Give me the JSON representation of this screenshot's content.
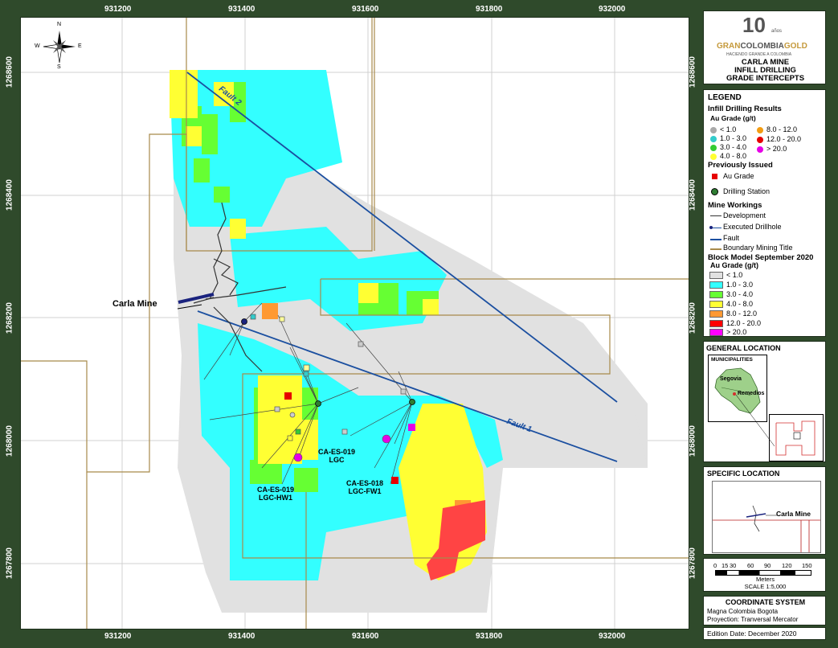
{
  "axis": {
    "x_ticks": [
      "931200",
      "931400",
      "931600",
      "931800",
      "932000"
    ],
    "y_ticks": [
      "1268600",
      "1268400",
      "1268200",
      "1268000",
      "1267800"
    ]
  },
  "compass": {
    "n": "N",
    "s": "S",
    "e": "E",
    "w": "W"
  },
  "map_labels": {
    "carla_mine": "Carla Mine",
    "fault1": "Fault 1",
    "fault2": "Fault 2",
    "drill1_line1": "CA-ES-019",
    "drill1_line2": "LGC",
    "drill2_line1": "CA-ES-019",
    "drill2_line2": "LGC-HW1",
    "drill3_line1": "CA-ES-018",
    "drill3_line2": "LGC-FW1"
  },
  "logo": {
    "number": "10",
    "small": "años",
    "brand_part1": "GRAN",
    "brand_part2": "COLOMBIA",
    "brand_part3": "GOLD",
    "tagline": "HACIENDO GRANDE A COLOMBIA",
    "title_lines": [
      "CARLA MINE",
      "INFILL DRILLING",
      "GRADE INTERCEPTS"
    ]
  },
  "legend": {
    "title": "LEGEND",
    "infill_title": "Infill Drilling Results",
    "au_grade": "Au Grade (g/t)",
    "infill_left": [
      {
        "label": "< 1.0",
        "color": "#a9a9a9"
      },
      {
        "label": "1.0 - 3.0",
        "color": "#33cccc"
      },
      {
        "label": "3.0 - 4.0",
        "color": "#33cc33"
      },
      {
        "label": "4.0 - 8.0",
        "color": "#ffff33"
      }
    ],
    "infill_right": [
      {
        "label": "8.0 - 12.0",
        "color": "#f39c12"
      },
      {
        "label": "12.0 - 20.0",
        "color": "#e60000"
      },
      {
        "label": "> 20.0",
        "color": "#e600e6"
      }
    ],
    "prev_title": "Previously Issued",
    "prev_au": "Au Grade",
    "prev_station": "Drilling Station",
    "mine_title": "Mine Workings",
    "mine_items": [
      "Development",
      "Executed Drillhole",
      "Fault",
      "Boundary Mining Title"
    ],
    "block_title": "Block Model September 2020",
    "block_grade": "Au Grade (g/t)",
    "block_items": [
      {
        "label": "< 1.0",
        "color": "#e1e1e1"
      },
      {
        "label": "1.0 - 3.0",
        "color": "#33ffff"
      },
      {
        "label": "3.0 - 4.0",
        "color": "#66ff33"
      },
      {
        "label": "4.0 - 8.0",
        "color": "#ffff33"
      },
      {
        "label": "8.0 - 12.0",
        "color": "#ff9933"
      },
      {
        "label": "12.0 - 20.0",
        "color": "#ff0000"
      },
      {
        "label": "> 20.0",
        "color": "#ff00ff"
      }
    ]
  },
  "general_location": {
    "title": "GENERAL LOCATION",
    "inset_title": "MUNICIPALITIES",
    "segovia": "Segovia",
    "remedios": "Remedios"
  },
  "specific_location": {
    "title": "SPECIFIC LOCATION",
    "label": "Carla Mine"
  },
  "scale": {
    "ticks": [
      "0",
      "15",
      "30",
      "60",
      "90",
      "120",
      "150"
    ],
    "units": "Meters",
    "text": "SCALE 1:5,000"
  },
  "coord": {
    "title": "COORDINATE SYSTEM",
    "line1": "Magna Colombia Bogota",
    "line2": "Proyection: Tranversal Mercator",
    "edition": "Edition Date: December 2020"
  }
}
